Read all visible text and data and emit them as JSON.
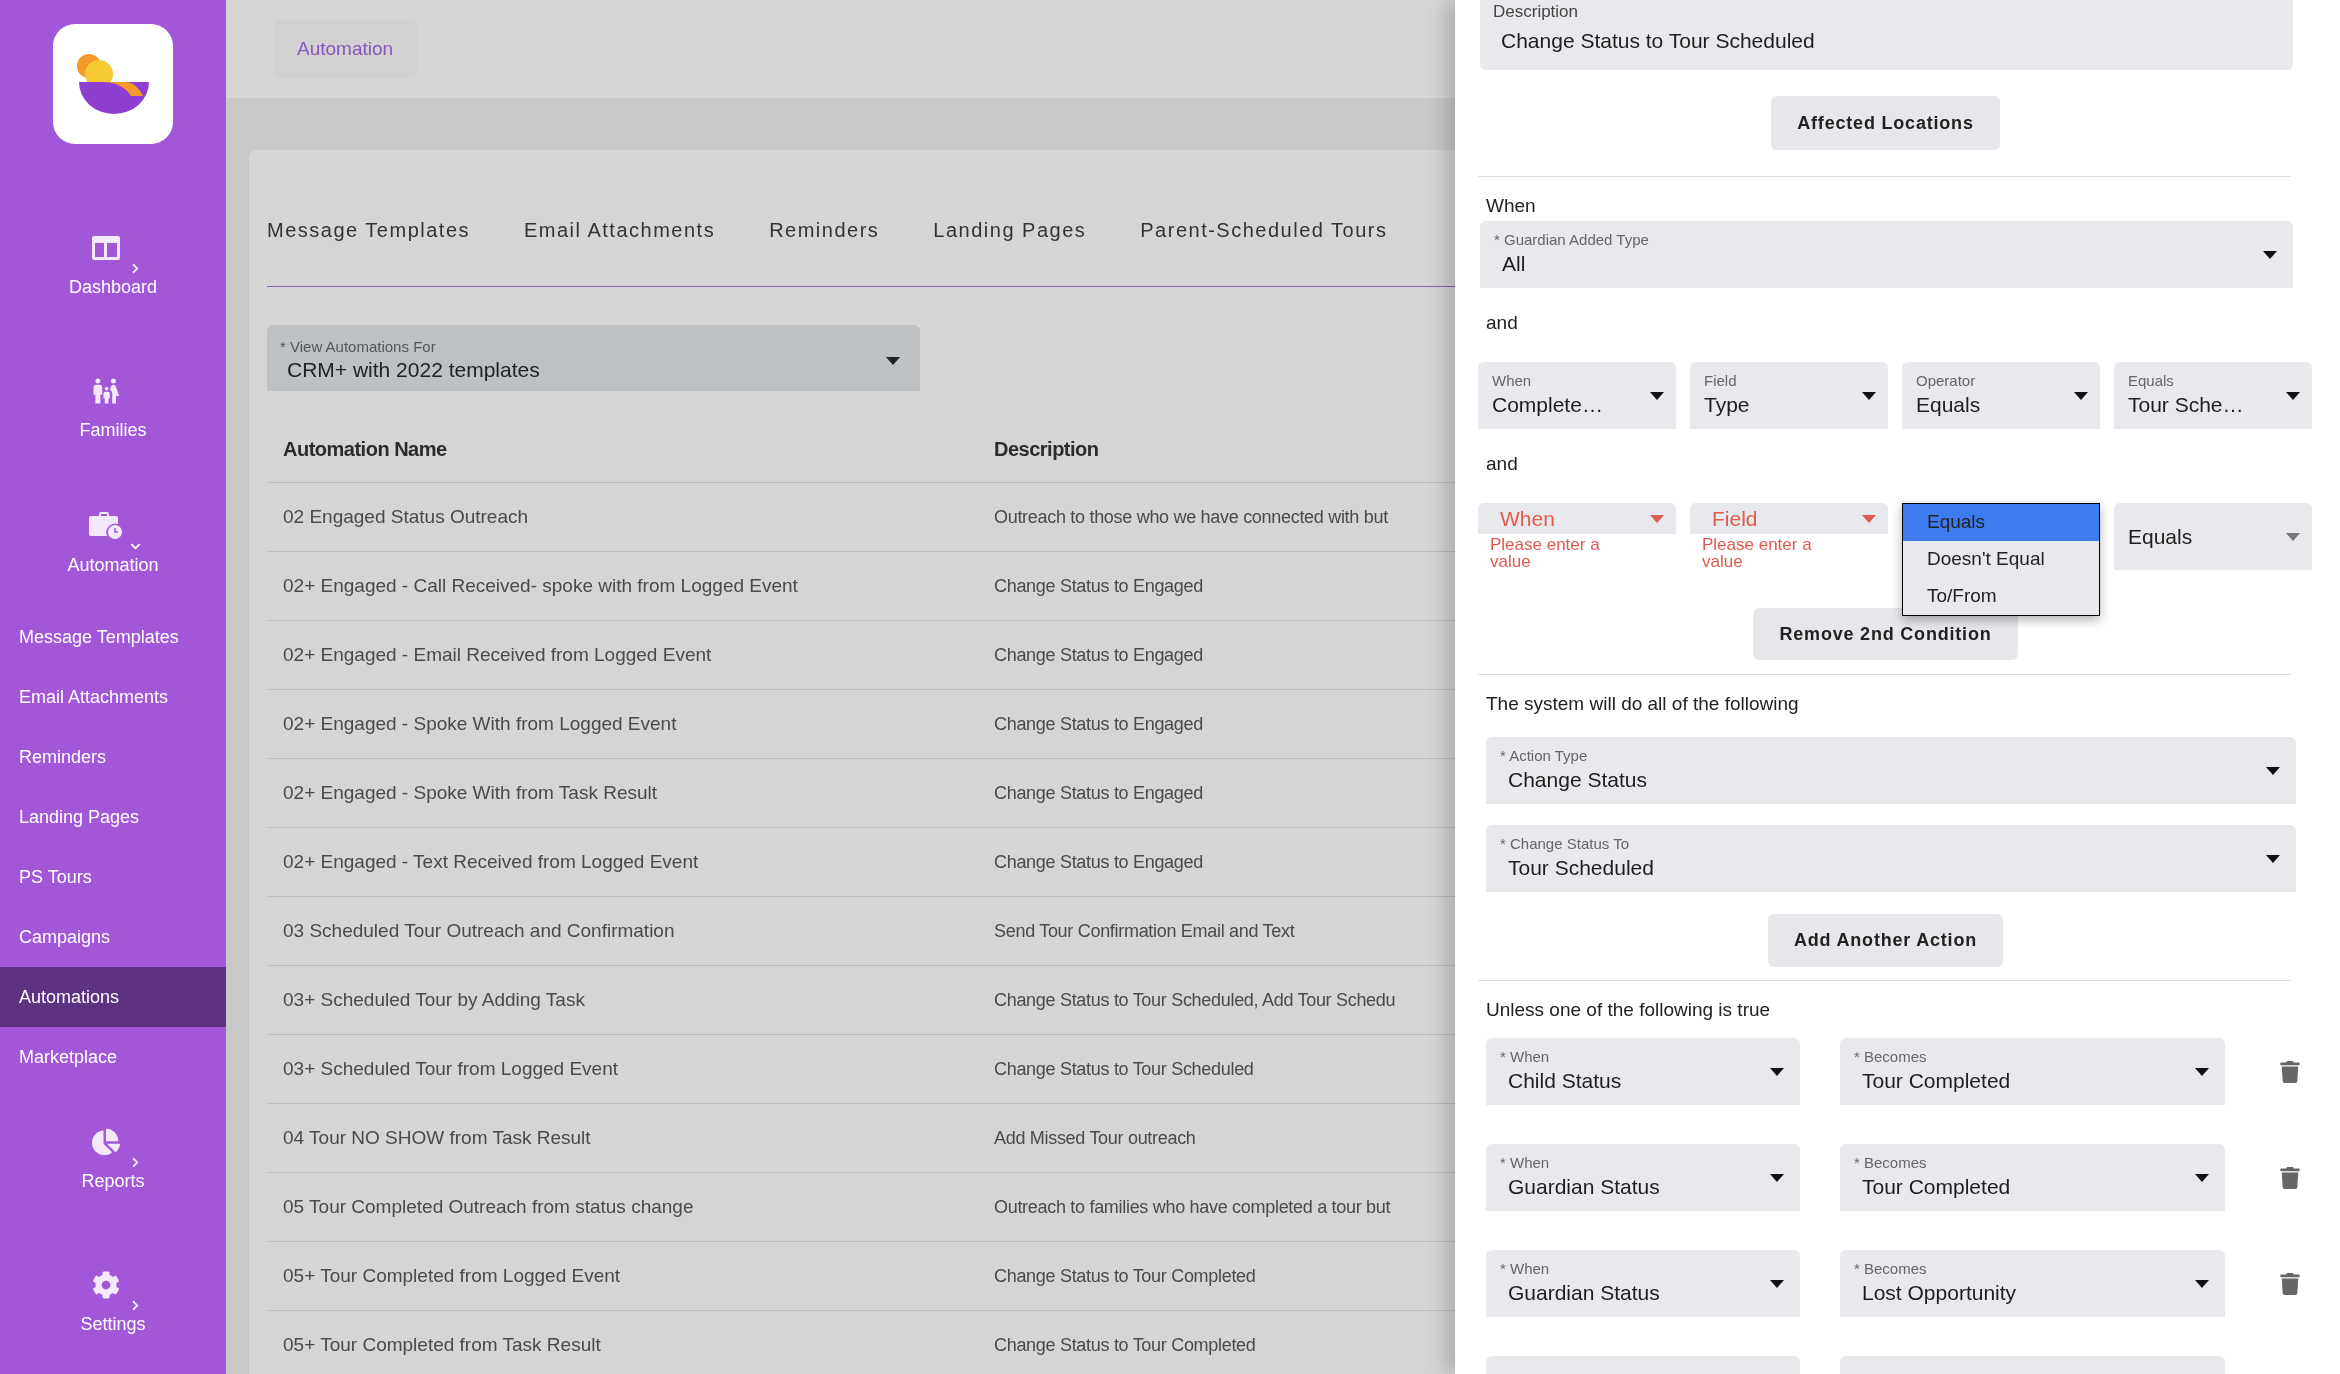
{
  "sidebar": {
    "items": [
      {
        "label": "Dashboard",
        "kind": "group",
        "expanded": false
      },
      {
        "label": "Families",
        "kind": "link"
      },
      {
        "label": "Automation",
        "kind": "group",
        "expanded": true,
        "children": [
          {
            "label": "Message Templates",
            "selected": false
          },
          {
            "label": "Email Attachments",
            "selected": false
          },
          {
            "label": "Reminders",
            "selected": false
          },
          {
            "label": "Landing Pages",
            "selected": false
          },
          {
            "label": "PS Tours",
            "selected": false
          },
          {
            "label": "Campaigns",
            "selected": false
          },
          {
            "label": "Automations",
            "selected": true
          },
          {
            "label": "Marketplace",
            "selected": false
          }
        ]
      },
      {
        "label": "Reports",
        "kind": "group",
        "expanded": false
      },
      {
        "label": "Settings",
        "kind": "group",
        "expanded": false
      }
    ]
  },
  "breadcrumb": "Automation",
  "tabs": [
    {
      "label": "Message Templates",
      "selected": false
    },
    {
      "label": "Email Attachments",
      "selected": false
    },
    {
      "label": "Reminders",
      "selected": false
    },
    {
      "label": "Landing Pages",
      "selected": false
    },
    {
      "label": "Parent-Scheduled Tours",
      "selected": false
    }
  ],
  "view_select": {
    "label": "* View Automations For",
    "value": "CRM+ with 2022 templates"
  },
  "table": {
    "columns": [
      "Automation Name",
      "Description"
    ],
    "rows": [
      [
        "02 Engaged Status Outreach",
        "Outreach to those who we have connected with but"
      ],
      [
        "02+ Engaged - Call Received- spoke with from Logged Event",
        "Change Status to Engaged"
      ],
      [
        "02+ Engaged - Email Received from Logged Event",
        "Change Status to Engaged"
      ],
      [
        "02+ Engaged - Spoke With from Logged Event",
        "Change Status to Engaged"
      ],
      [
        "02+ Engaged - Spoke With from Task Result",
        "Change Status to Engaged"
      ],
      [
        "02+ Engaged - Text Received from Logged Event",
        "Change Status to Engaged"
      ],
      [
        "03 Scheduled Tour Outreach and Confirmation",
        "Send Tour Confirmation Email and Text"
      ],
      [
        "03+ Scheduled Tour by Adding Task",
        "Change Status to Tour Scheduled, Add Tour Schedu"
      ],
      [
        "03+ Scheduled Tour from Logged Event",
        "Change Status to Tour Scheduled"
      ],
      [
        "04 Tour NO SHOW from Task Result",
        "Add Missed Tour outreach"
      ],
      [
        "05 Tour Completed Outreach from status change",
        "Outreach to families who have completed a tour but"
      ],
      [
        "05+ Tour Completed from Logged Event",
        "Change Status to Tour Completed"
      ],
      [
        "05+ Tour Completed from Task Result",
        "Change Status to Tour Completed"
      ]
    ]
  },
  "drawer": {
    "description_field": {
      "label": "Description",
      "value": "Change Status to Tour Scheduled"
    },
    "affected_locations_button": "Affected Locations",
    "when_heading": "When",
    "guardian_added_type": {
      "label": "* Guardian Added Type",
      "value": "All"
    },
    "conditions": [
      {
        "heading": "and",
        "fields": [
          {
            "kind": "select",
            "label": "When",
            "value": "Complete…",
            "invalid": false
          },
          {
            "kind": "select",
            "label": "Field",
            "value": "Type",
            "invalid": false
          },
          {
            "kind": "select",
            "label": "Operator",
            "value": "Equals",
            "invalid": false
          },
          {
            "kind": "select",
            "label": "Equals",
            "value": "Tour Sche…",
            "invalid": false
          }
        ]
      },
      {
        "heading": "and",
        "fields": [
          {
            "kind": "select",
            "placeholder": "When",
            "invalid": true,
            "error": "Please enter a value"
          },
          {
            "kind": "select",
            "placeholder": "Field",
            "invalid": true,
            "error": "Please enter a value"
          },
          {
            "kind": "menu",
            "options": [
              {
                "label": "Equals",
                "selected": true
              },
              {
                "label": "Doesn't Equal",
                "selected": false
              },
              {
                "label": "To/From",
                "selected": false
              }
            ]
          },
          {
            "kind": "select",
            "value": "Equals",
            "invalid": false
          }
        ]
      }
    ],
    "remove_condition_button": "Remove 2nd Condition",
    "actions_heading": "The system will do all of the following",
    "actions": [
      {
        "label": "* Action Type",
        "value": "Change Status"
      },
      {
        "label": "* Change Status To",
        "value": "Tour Scheduled"
      }
    ],
    "add_action_button": "Add Another Action",
    "exceptions_heading": "Unless one of the following is true",
    "exceptions": [
      {
        "when": {
          "label": "* When",
          "value": "Child Status"
        },
        "becomes": {
          "label": "* Becomes",
          "value": "Tour Completed"
        }
      },
      {
        "when": {
          "label": "* When",
          "value": "Guardian Status"
        },
        "becomes": {
          "label": "* Becomes",
          "value": "Tour Completed"
        }
      },
      {
        "when": {
          "label": "* When",
          "value": "Guardian Status"
        },
        "becomes": {
          "label": "* Becomes",
          "value": "Lost Opportunity"
        }
      }
    ]
  }
}
